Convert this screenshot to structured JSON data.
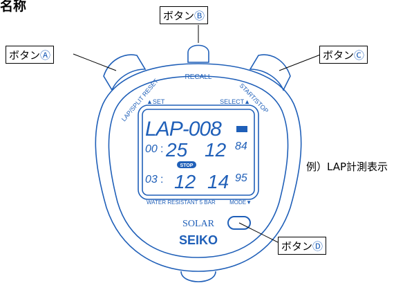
{
  "heading": "名称",
  "example_label": "例）LAP計測表示",
  "callouts": {
    "a": {
      "text": "ボタン",
      "mark": "Ⓐ"
    },
    "b": {
      "text": "ボタン",
      "mark": "Ⓑ"
    },
    "c": {
      "text": "ボタン",
      "mark": "Ⓒ"
    },
    "d": {
      "text": "ボタン",
      "mark": "Ⓓ"
    }
  },
  "bezel": {
    "recall": "RECALL",
    "lap_split_reset": "LAP/SPLIT RESET",
    "start_stop": "START/STOP",
    "set": "▲SET",
    "select": "SELECT▲",
    "water_resistant": "WATER RESISTANT 5 BAR",
    "mode": "MODE▼",
    "solar": "SOLAR",
    "brand": "SEIKO"
  },
  "display": {
    "row1": "LAP-008",
    "row2_hours": "00",
    "row2_min": "25",
    "row2_sec": "12",
    "row2_hund": "84",
    "stop_badge": "STOP",
    "row3_hours": "03",
    "row3_min": "12",
    "row3_sec": "14",
    "row3_hund": "95"
  },
  "colors": {
    "line": "#1f5fb8",
    "lcd_text": "#1f5fb8",
    "outline": "#000000"
  }
}
